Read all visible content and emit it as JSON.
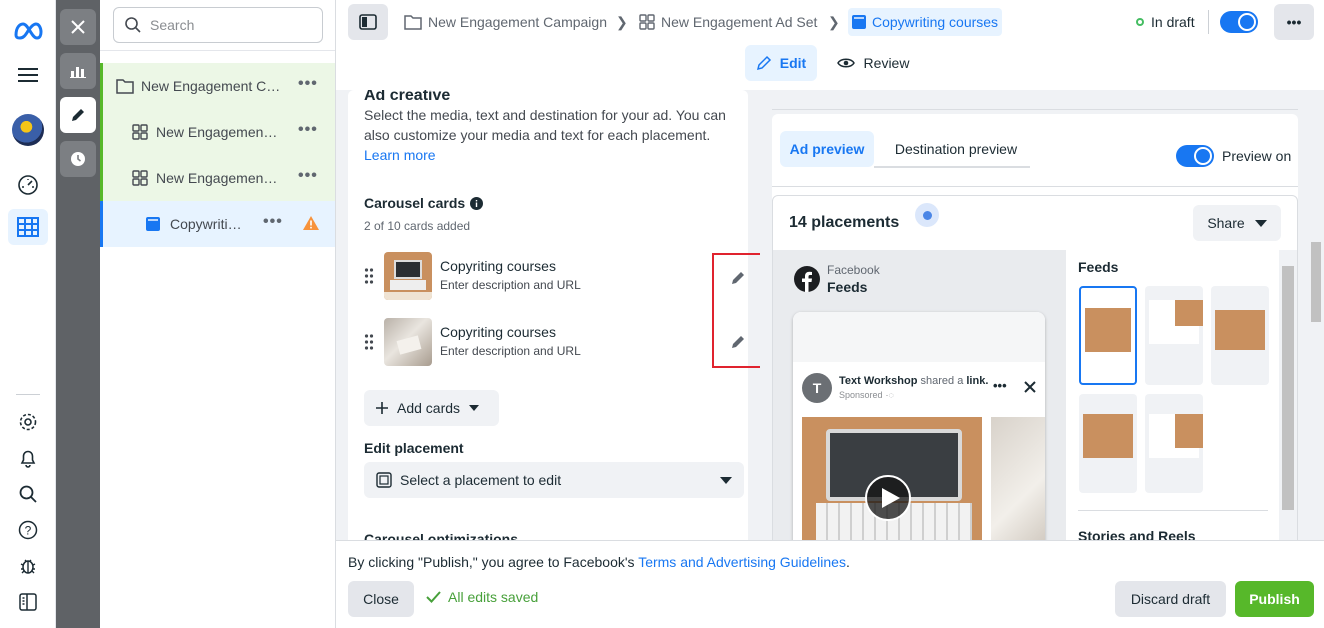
{
  "tree": {
    "search_placeholder": "Search",
    "items": [
      {
        "label": "New Engagement Campaign",
        "level": "campaign"
      },
      {
        "label": "New Engagement Ad Set",
        "level": "adset"
      },
      {
        "label": "New Engagement Ad Set",
        "level": "adset"
      },
      {
        "label": "Copywriting courses",
        "level": "ad"
      }
    ]
  },
  "breadcrumb": {
    "campaign": "New Engagement Campaign",
    "adset": "New Engagement Ad Set",
    "ad": "Copywriting courses"
  },
  "status": {
    "label": "In draft",
    "color": "#45bd62"
  },
  "mode_tabs": {
    "edit": "Edit",
    "review": "Review"
  },
  "ad_creative": {
    "title": "Ad creative",
    "description": "Select the media, text and destination for your ad. You can also customize your media and text for each placement.",
    "learn_more": "Learn more"
  },
  "carousel": {
    "title": "Carousel cards",
    "count_text": "2 of 10 cards added",
    "cards": [
      {
        "title": "Copyriting courses",
        "subtitle": "Enter description and URL"
      },
      {
        "title": "Copyriting courses",
        "subtitle": "Enter description and URL"
      }
    ],
    "add_cards": "Add cards"
  },
  "edit_placement": {
    "title": "Edit placement",
    "select_label": "Select a placement to edit"
  },
  "carousel_opt": {
    "title": "Carousel optimizations"
  },
  "preview": {
    "tab_ad": "Ad preview",
    "tab_destination": "Destination preview",
    "toggle_label": "Preview on",
    "placements_count": "14 placements",
    "share": "Share",
    "platform": "Facebook",
    "placement": "Feeds",
    "post_author": "Text Workshop",
    "post_action": "shared a",
    "post_link": "link.",
    "sponsored": "Sponsored",
    "avatar_letter": "T",
    "feeds_heading": "Feeds",
    "stories_heading": "Stories and Reels"
  },
  "footer": {
    "notice_prefix": "By clicking \"Publish,\" you agree to Facebook's",
    "notice_link": "Terms and Advertising Guidelines",
    "notice_suffix": ".",
    "close": "Close",
    "saved": "All edits saved",
    "discard": "Discard draft",
    "publish": "Publish"
  },
  "colors": {
    "accent": "#1877f2",
    "publish_green": "#57b82a",
    "highlight_red": "#e0232e",
    "tree_selected_bg": "#e7f3ff",
    "tree_green_bg": "#ecf7e6",
    "warning": "#f7923b"
  }
}
